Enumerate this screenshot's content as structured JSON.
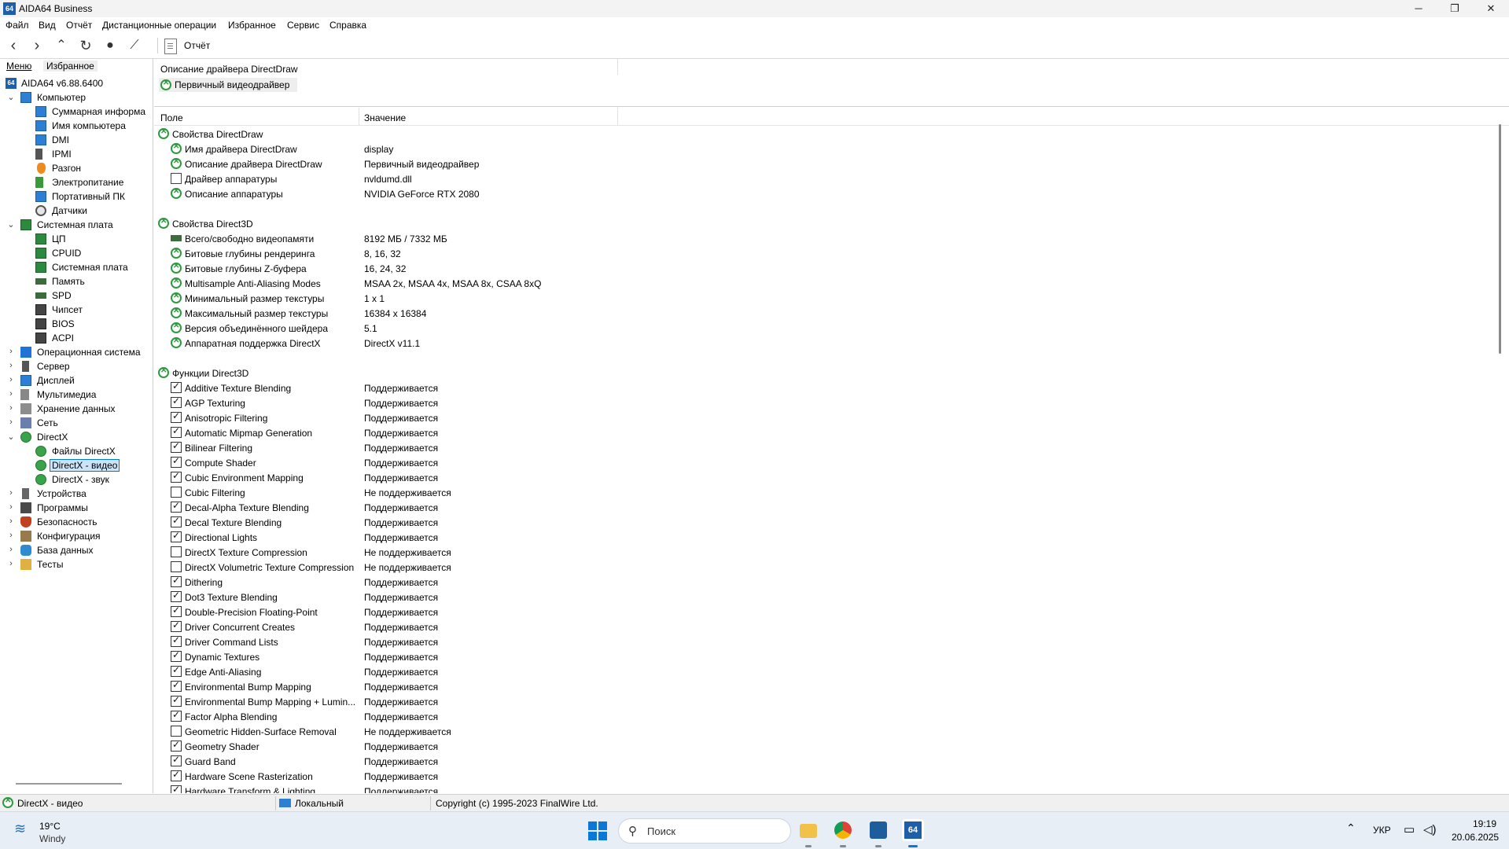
{
  "window": {
    "title": "AIDA64 Business",
    "app_icon": "64"
  },
  "menu": [
    "Файл",
    "Вид",
    "Отчёт",
    "Дистанционные операции",
    "Избранное",
    "Сервис",
    "Справка"
  ],
  "toolbar": {
    "report_label": "Отчёт"
  },
  "left_tabs": {
    "menu": "Меню",
    "favorites": "Избранное"
  },
  "tree": {
    "root": "AIDA64 v6.88.6400",
    "computer": "Компьютер",
    "computer_items": [
      "Суммарная информа",
      "Имя компьютера",
      "DMI",
      "IPMI",
      "Разгон",
      "Электропитание",
      "Портативный ПК",
      "Датчики"
    ],
    "board": "Системная плата",
    "board_items": [
      "ЦП",
      "CPUID",
      "Системная плата",
      "Память",
      "SPD",
      "Чипсет",
      "BIOS",
      "ACPI"
    ],
    "mid_items": [
      "Операционная система",
      "Сервер",
      "Дисплей",
      "Мультимедиа",
      "Хранение данных",
      "Сеть"
    ],
    "directx": "DirectX",
    "directx_items": [
      "Файлы DirectX",
      "DirectX - видео",
      "DirectX - звук"
    ],
    "bottom_items": [
      "Устройства",
      "Программы",
      "Безопасность",
      "Конфигурация",
      "База данных",
      "Тесты"
    ]
  },
  "top_pane": {
    "header": "Описание драйвера DirectDraw",
    "item": "Первичный видеодрайвер"
  },
  "columns": {
    "field": "Поле",
    "value": "Значение"
  },
  "sections": [
    {
      "title": "Свойства DirectDraw",
      "rows": [
        {
          "icon": "xbox",
          "field": "Имя драйвера DirectDraw",
          "value": "display"
        },
        {
          "icon": "xbox",
          "field": "Описание драйвера DirectDraw",
          "value": "Первичный видеодрайвер"
        },
        {
          "icon": "driver",
          "field": "Драйвер аппаратуры",
          "value": "nvldumd.dll"
        },
        {
          "icon": "xbox",
          "field": "Описание аппаратуры",
          "value": "NVIDIA GeForce RTX 2080"
        }
      ]
    },
    {
      "title": "Свойства Direct3D",
      "rows": [
        {
          "icon": "ram",
          "field": "Всего/свободно видеопамяти",
          "value": "8192 МБ / 7332 МБ"
        },
        {
          "icon": "xbox",
          "field": "Битовые глубины рендеринга",
          "value": "8, 16, 32"
        },
        {
          "icon": "xbox",
          "field": "Битовые глубины Z-буфера",
          "value": "16, 24, 32"
        },
        {
          "icon": "xbox",
          "field": "Multisample Anti-Aliasing Modes",
          "value": "MSAA 2x, MSAA 4x, MSAA 8x, CSAA 8xQ"
        },
        {
          "icon": "xbox",
          "field": "Минимальный размер текстуры",
          "value": "1 x 1"
        },
        {
          "icon": "xbox",
          "field": "Максимальный размер текстуры",
          "value": "16384 x 16384"
        },
        {
          "icon": "xbox",
          "field": "Версия объединённого шейдера",
          "value": "5.1"
        },
        {
          "icon": "xbox",
          "field": "Аппаратная поддержка DirectX",
          "value": "DirectX v11.1"
        }
      ]
    },
    {
      "title": "Функции Direct3D",
      "rows": [
        {
          "icon": "check-on",
          "field": "Additive Texture Blending",
          "value": "Поддерживается"
        },
        {
          "icon": "check-on",
          "field": "AGP Texturing",
          "value": "Поддерживается"
        },
        {
          "icon": "check-on",
          "field": "Anisotropic Filtering",
          "value": "Поддерживается"
        },
        {
          "icon": "check-on",
          "field": "Automatic Mipmap Generation",
          "value": "Поддерживается"
        },
        {
          "icon": "check-on",
          "field": "Bilinear Filtering",
          "value": "Поддерживается"
        },
        {
          "icon": "check-on",
          "field": "Compute Shader",
          "value": "Поддерживается"
        },
        {
          "icon": "check-on",
          "field": "Cubic Environment Mapping",
          "value": "Поддерживается"
        },
        {
          "icon": "check-off",
          "field": "Cubic Filtering",
          "value": "Не поддерживается"
        },
        {
          "icon": "check-on",
          "field": "Decal-Alpha Texture Blending",
          "value": "Поддерживается"
        },
        {
          "icon": "check-on",
          "field": "Decal Texture Blending",
          "value": "Поддерживается"
        },
        {
          "icon": "check-on",
          "field": "Directional Lights",
          "value": "Поддерживается"
        },
        {
          "icon": "check-off",
          "field": "DirectX Texture Compression",
          "value": "Не поддерживается"
        },
        {
          "icon": "check-off",
          "field": "DirectX Volumetric Texture Compression",
          "value": "Не поддерживается"
        },
        {
          "icon": "check-on",
          "field": "Dithering",
          "value": "Поддерживается"
        },
        {
          "icon": "check-on",
          "field": "Dot3 Texture Blending",
          "value": "Поддерживается"
        },
        {
          "icon": "check-on",
          "field": "Double-Precision Floating-Point",
          "value": "Поддерживается"
        },
        {
          "icon": "check-on",
          "field": "Driver Concurrent Creates",
          "value": "Поддерживается"
        },
        {
          "icon": "check-on",
          "field": "Driver Command Lists",
          "value": "Поддерживается"
        },
        {
          "icon": "check-on",
          "field": "Dynamic Textures",
          "value": "Поддерживается"
        },
        {
          "icon": "check-on",
          "field": "Edge Anti-Aliasing",
          "value": "Поддерживается"
        },
        {
          "icon": "check-on",
          "field": "Environmental Bump Mapping",
          "value": "Поддерживается"
        },
        {
          "icon": "check-on",
          "field": "Environmental Bump Mapping + Lumin...",
          "value": "Поддерживается"
        },
        {
          "icon": "check-on",
          "field": "Factor Alpha Blending",
          "value": "Поддерживается"
        },
        {
          "icon": "check-off",
          "field": "Geometric Hidden-Surface Removal",
          "value": "Не поддерживается"
        },
        {
          "icon": "check-on",
          "field": "Geometry Shader",
          "value": "Поддерживается"
        },
        {
          "icon": "check-on",
          "field": "Guard Band",
          "value": "Поддерживается"
        },
        {
          "icon": "check-on",
          "field": "Hardware Scene Rasterization",
          "value": "Поддерживается"
        },
        {
          "icon": "check-on",
          "field": "Hardware Transform & Lighting",
          "value": "Поддерживается"
        }
      ]
    }
  ],
  "status": {
    "left": "DirectX - видео",
    "mid": "Локальный",
    "right": "Copyright (c) 1995-2023 FinalWire Ltd."
  },
  "taskbar": {
    "temp": "19°C",
    "condition": "Windy",
    "search_placeholder": "Поиск",
    "lang": "УКР",
    "time": "19:19",
    "date": "20.06.2025",
    "accent": "#0a78d8"
  }
}
